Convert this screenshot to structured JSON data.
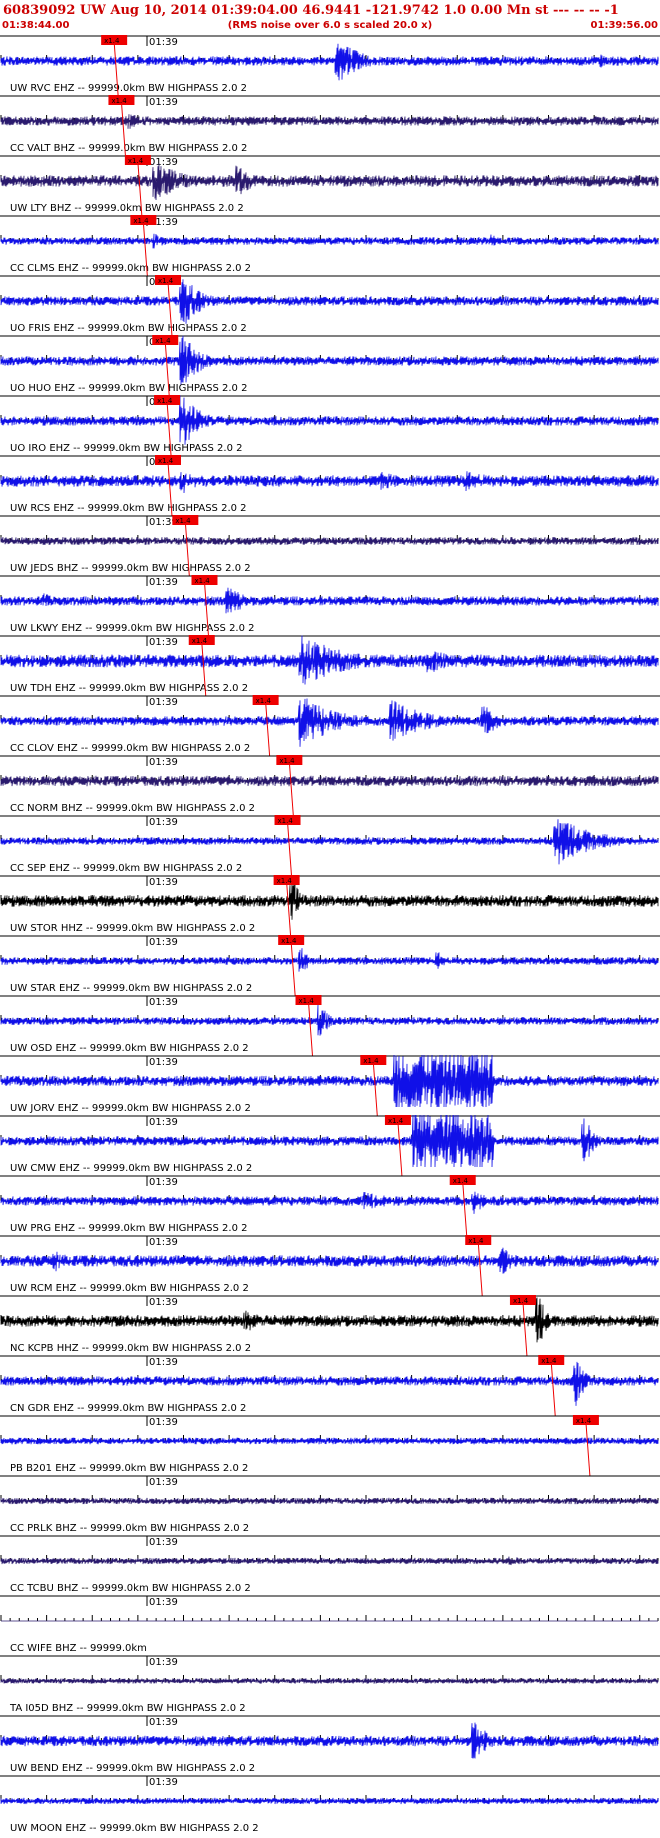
{
  "header": {
    "title": "60839092 UW Aug 10, 2014 01:39:04.00   46.9441 -121.9742  1.0 0.00 Mn st --- -- --  -1",
    "start_time": "01:38:44.00",
    "note": "(RMS noise over 6.0 s scaled 20.0 x)",
    "end_time": "01:39:56.00"
  },
  "chart_data": {
    "type": "line",
    "title": "60839092 UW Aug 10, 2014 01:39:04.00   46.9441 -121.9742  1.0 0.00 Mn st --- -- --  -1",
    "x_range": [
      "01:38:44.00",
      "01:39:56.00"
    ],
    "x_range_seconds": [
      0,
      72
    ],
    "minute_mark": "01:39",
    "minute_mark_seconds": 16,
    "pick_label": "x1.4",
    "colors": {
      "blue": "#1010e8",
      "navy": "#2a1a6e",
      "black": "#000000",
      "pick": "#ee0000",
      "header": "#cc0000"
    },
    "traces": [
      {
        "label": "UW RVC EHZ -- 99999.0km BW  HIGHPASS  2.0  2",
        "color": "blue",
        "pick_sec": 12.4,
        "amp": 0.18,
        "events": [
          [
            37,
            0.9,
            2.5
          ],
          [
            66,
            0.25,
            1.5
          ]
        ],
        "sat": []
      },
      {
        "label": "CC VALT BHZ -- 99999.0km BW  HIGHPASS  2.0  2",
        "color": "navy",
        "pick_sec": 13.2,
        "amp": 0.18,
        "events": [
          [
            14,
            0.35,
            2
          ]
        ],
        "sat": []
      },
      {
        "label": "UW LTY BHZ -- 99999.0km BW  HIGHPASS  2.0  2",
        "color": "navy",
        "pick_sec": 15.0,
        "amp": 0.22,
        "events": [
          [
            17,
            0.8,
            3
          ],
          [
            26,
            0.6,
            2
          ]
        ],
        "sat": []
      },
      {
        "label": "CC CLMS EHZ -- 99999.0km BW  HIGHPASS  2.0  2",
        "color": "blue",
        "pick_sec": 15.6,
        "amp": 0.15,
        "events": [
          [
            17,
            0.3,
            1.5
          ],
          [
            54,
            0.25,
            1
          ]
        ],
        "sat": []
      },
      {
        "label": "UO FRIS EHZ -- 99999.0km BW  HIGHPASS  2.0  2",
        "color": "blue",
        "pick_sec": 18.3,
        "amp": 0.18,
        "events": [
          [
            20,
            1.0,
            2
          ]
        ],
        "sat": []
      },
      {
        "label": "UO HUO EHZ -- 99999.0km BW  HIGHPASS  2.0  2",
        "color": "blue",
        "pick_sec": 18.0,
        "amp": 0.18,
        "events": [
          [
            20,
            1.0,
            2
          ]
        ],
        "sat": []
      },
      {
        "label": "UO IRO EHZ -- 99999.0km BW  HIGHPASS  2.0  2",
        "color": "blue",
        "pick_sec": 18.2,
        "amp": 0.18,
        "events": [
          [
            20,
            1.0,
            2
          ]
        ],
        "sat": []
      },
      {
        "label": "UW RCS EHZ -- 99999.0km BW  HIGHPASS  2.0  2",
        "color": "blue",
        "pick_sec": 18.3,
        "amp": 0.22,
        "events": [
          [
            20,
            0.5,
            2
          ],
          [
            42,
            0.35,
            3
          ],
          [
            51,
            0.4,
            4
          ]
        ],
        "sat": []
      },
      {
        "label": "UW JEDS BHZ -- 99999.0km BW  HIGHPASS  2.0  2",
        "color": "navy",
        "pick_sec": 20.2,
        "amp": 0.15,
        "events": [],
        "sat": []
      },
      {
        "label": "UW LKWY EHZ -- 99999.0km BW  HIGHPASS  2.0  2",
        "color": "blue",
        "pick_sec": 22.3,
        "amp": 0.18,
        "events": [
          [
            25,
            0.6,
            2
          ],
          [
            5,
            0.3,
            1
          ]
        ],
        "sat": []
      },
      {
        "label": "UW TDH EHZ -- 99999.0km BW  HIGHPASS  2.0  2",
        "color": "blue",
        "pick_sec": 22.0,
        "amp": 0.25,
        "events": [
          [
            33,
            1.0,
            5
          ],
          [
            47,
            0.5,
            3
          ]
        ],
        "sat": []
      },
      {
        "label": "CC CLOV EHZ -- 99999.0km BW  HIGHPASS  2.0  2",
        "color": "blue",
        "pick_sec": 29.0,
        "amp": 0.18,
        "events": [
          [
            33,
            1.0,
            4
          ],
          [
            43,
            0.8,
            4
          ],
          [
            53,
            0.6,
            2
          ]
        ],
        "sat": []
      },
      {
        "label": "CC NORM BHZ -- 99999.0km BW  HIGHPASS  2.0  2",
        "color": "navy",
        "pick_sec": 31.6,
        "amp": 0.2,
        "events": [],
        "sat": []
      },
      {
        "label": "CC SEP EHZ -- 99999.0km BW  HIGHPASS  2.0  2",
        "color": "blue",
        "pick_sec": 31.4,
        "amp": 0.15,
        "events": [
          [
            61,
            1.0,
            4
          ]
        ],
        "sat": []
      },
      {
        "label": "UW STOR HHZ -- 99999.0km BW  HIGHPASS  2.0  2",
        "color": "black",
        "pick_sec": 31.3,
        "amp": 0.22,
        "events": [
          [
            32,
            0.8,
            1
          ]
        ],
        "sat": []
      },
      {
        "label": "UW STAR EHZ -- 99999.0km BW  HIGHPASS  2.0  2",
        "color": "blue",
        "pick_sec": 31.8,
        "amp": 0.15,
        "events": [
          [
            33,
            0.5,
            1
          ],
          [
            48,
            0.35,
            1
          ]
        ],
        "sat": []
      },
      {
        "label": "UW OSD EHZ -- 99999.0km BW  HIGHPASS  2.0  2",
        "color": "blue",
        "pick_sec": 33.7,
        "amp": 0.15,
        "events": [
          [
            35,
            0.7,
            1
          ]
        ],
        "sat": []
      },
      {
        "label": "UW JORV EHZ -- 99999.0km BW  HIGHPASS  2.0  2",
        "color": "blue",
        "pick_sec": 40.8,
        "amp": 0.2,
        "events": [],
        "sat": [
          [
            43,
            54
          ]
        ]
      },
      {
        "label": "UW CMW EHZ -- 99999.0km BW  HIGHPASS  2.0  2",
        "color": "blue",
        "pick_sec": 43.5,
        "amp": 0.18,
        "events": [
          [
            64,
            1.0,
            1
          ]
        ],
        "sat": [
          [
            45,
            54
          ]
        ]
      },
      {
        "label": "UW PRG EHZ -- 99999.0km BW  HIGHPASS  2.0  2",
        "color": "blue",
        "pick_sec": 50.6,
        "amp": 0.18,
        "events": [
          [
            52,
            0.5,
            1.5
          ],
          [
            40,
            0.35,
            4
          ]
        ],
        "sat": []
      },
      {
        "label": "UW RCM EHZ -- 99999.0km BW  HIGHPASS  2.0  2",
        "color": "blue",
        "pick_sec": 52.3,
        "amp": 0.22,
        "events": [
          [
            55,
            0.6,
            1.5
          ],
          [
            6,
            0.4,
            2
          ]
        ],
        "sat": []
      },
      {
        "label": "NC KCPB HHZ -- 99999.0km BW  HIGHPASS  2.0  2",
        "color": "black",
        "pick_sec": 57.2,
        "amp": 0.22,
        "events": [
          [
            59,
            1.0,
            1
          ],
          [
            27,
            0.4,
            4
          ]
        ],
        "sat": []
      },
      {
        "label": "CN GDR EHZ -- 99999.0km BW  HIGHPASS  2.0  2",
        "color": "blue",
        "pick_sec": 60.3,
        "amp": 0.18,
        "events": [
          [
            63,
            1.0,
            1
          ]
        ],
        "sat": []
      },
      {
        "label": "PB B201 EHZ -- 99999.0km BW  HIGHPASS  2.0  2",
        "color": "blue",
        "pick_sec": 64.1,
        "amp": 0.13,
        "events": [],
        "sat": []
      },
      {
        "label": "CC PRLK BHZ -- 99999.0km BW  HIGHPASS  2.0  2",
        "color": "navy",
        "pick_sec": null,
        "amp": 0.12,
        "events": [],
        "sat": []
      },
      {
        "label": "CC TCBU BHZ -- 99999.0km BW  HIGHPASS  2.0  2",
        "color": "navy",
        "pick_sec": null,
        "amp": 0.12,
        "events": [
          [
            56,
            0.25,
            1
          ]
        ],
        "sat": []
      },
      {
        "label": "CC WIFE BHZ -- 99999.0km",
        "color": "navy",
        "pick_sec": null,
        "amp": 0,
        "events": [],
        "sat": []
      },
      {
        "label": "TA I05D BHZ -- 99999.0km BW  HIGHPASS  2.0  2",
        "color": "navy",
        "pick_sec": null,
        "amp": 0.1,
        "events": [],
        "sat": []
      },
      {
        "label": "UW BEND EHZ -- 99999.0km BW  HIGHPASS  2.0  2",
        "color": "blue",
        "pick_sec": null,
        "amp": 0.2,
        "events": [
          [
            52,
            0.8,
            1.5
          ]
        ],
        "sat": []
      },
      {
        "label": "UW MOON EHZ -- 99999.0km BW  HIGHPASS  2.0  2",
        "color": "blue",
        "pick_sec": null,
        "amp": 0.12,
        "events": [],
        "sat": []
      }
    ]
  }
}
